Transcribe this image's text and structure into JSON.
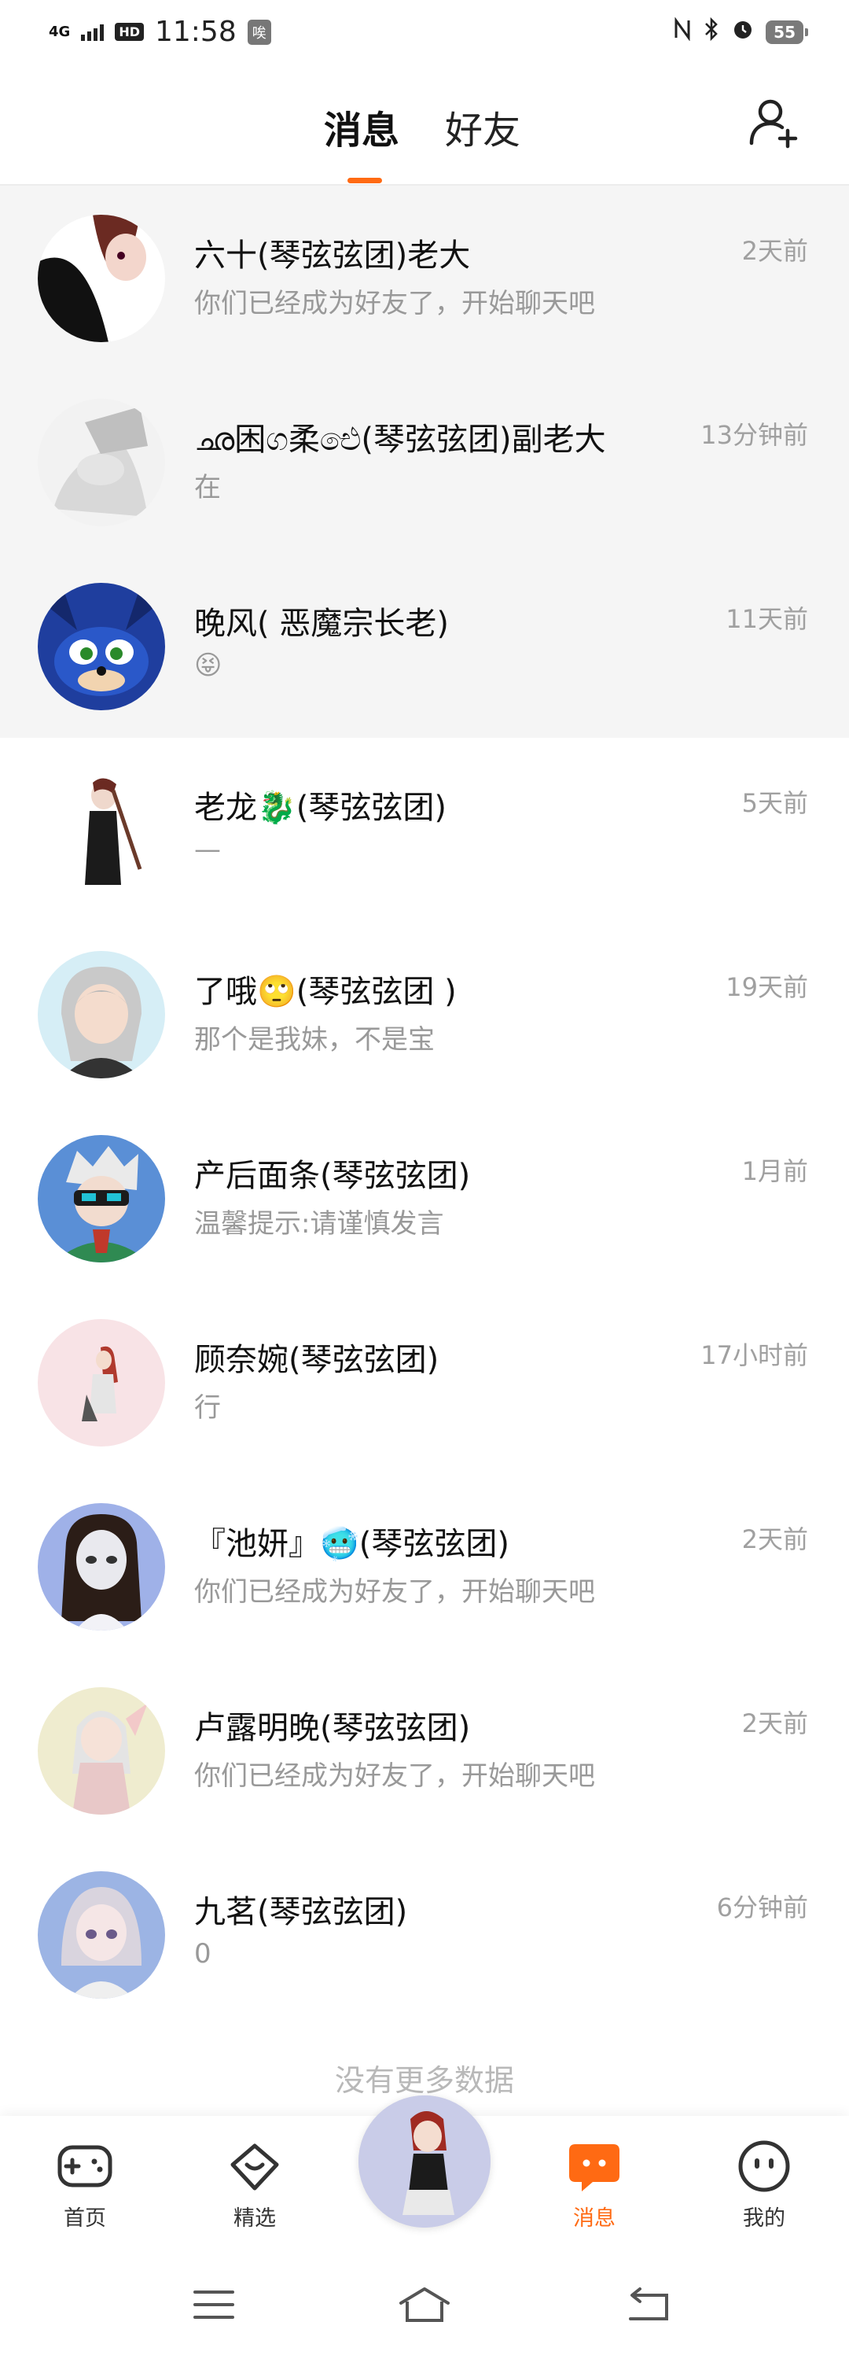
{
  "status_bar": {
    "network": "4G",
    "hd": "HD",
    "time": "11:58",
    "app_badge": "唉",
    "battery": "55"
  },
  "header": {
    "tabs": [
      {
        "label": "消息",
        "active": true
      },
      {
        "label": "好友",
        "active": false
      }
    ],
    "accent": "#ff6a13"
  },
  "conversations": [
    {
      "name": "六十(琴弦弦团)老大",
      "preview": "你们已经成为好友了，开始聊天吧",
      "time": "2天前",
      "pinned": true
    },
    {
      "name": "ഛ困ග柔ඓ(琴弦弦团)副老大",
      "preview": "在",
      "time": "13分钟前",
      "pinned": true
    },
    {
      "name": "晚风( 恶魔宗长老)",
      "preview": "😝",
      "time": "11天前",
      "pinned": true
    },
    {
      "name": "老龙🐉(琴弦弦团)",
      "preview": "—",
      "time": "5天前",
      "pinned": false
    },
    {
      "name": "了哦🙄(琴弦弦团 )",
      "preview": "那个是我妹，不是宝",
      "time": "19天前",
      "pinned": false
    },
    {
      "name": "产后面条(琴弦弦团)",
      "preview": "温馨提示:请谨慎发言",
      "time": "1月前",
      "pinned": false
    },
    {
      "name": "顾奈婉(琴弦弦团)",
      "preview": "行",
      "time": "17小时前",
      "pinned": false
    },
    {
      "name": "『池妍』🥶(琴弦弦团)",
      "preview": "你们已经成为好友了，开始聊天吧",
      "time": "2天前",
      "pinned": false
    },
    {
      "name": "卢露明晚(琴弦弦团)",
      "preview": "你们已经成为好友了，开始聊天吧",
      "time": "2天前",
      "pinned": false
    },
    {
      "name": "九茗(琴弦弦团)",
      "preview": "0",
      "time": "6分钟前",
      "pinned": false
    }
  ],
  "list_footer": "没有更多数据",
  "bottom_nav": [
    {
      "label": "首页",
      "icon": "gamepad-icon",
      "active": false
    },
    {
      "label": "精选",
      "icon": "heart-icon",
      "active": false
    },
    {
      "label": "消息",
      "icon": "chat-icon",
      "active": true
    },
    {
      "label": "我的",
      "icon": "face-icon",
      "active": false
    }
  ]
}
